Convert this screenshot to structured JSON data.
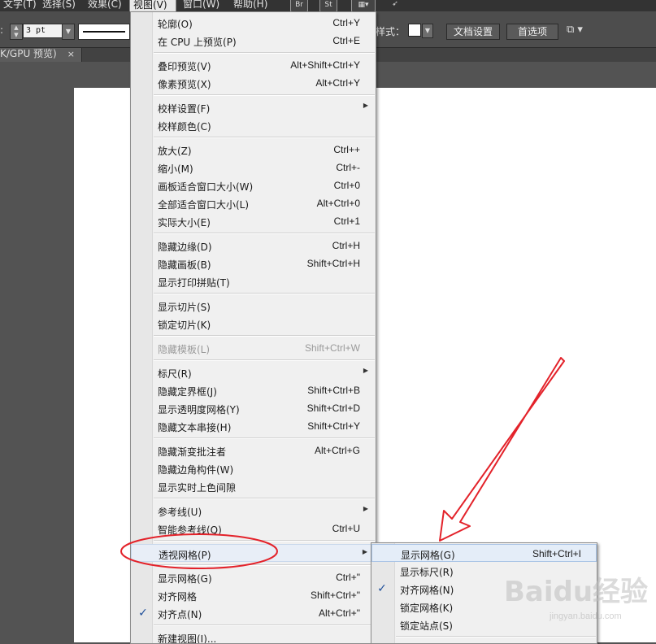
{
  "menubar": {
    "items": [
      "文字(T)",
      "选择(S)",
      "效果(C)",
      "视图(V)",
      "窗口(W)",
      "帮助(H)"
    ],
    "icons": [
      "Br",
      "St"
    ]
  },
  "controlbar": {
    "stroke_value": "3 pt",
    "style_label": "样式：",
    "doc_setup": "文档设置",
    "preferences": "首选项"
  },
  "doc_tab": {
    "label": "K/GPU 预览)",
    "close": "×"
  },
  "view_menu": {
    "items": [
      {
        "label": "轮廓(O)",
        "shortcut": "Ctrl+Y"
      },
      {
        "label": "在 CPU 上预览(P)",
        "shortcut": "Ctrl+E"
      },
      {
        "label": "叠印预览(V)",
        "shortcut": "Alt+Shift+Ctrl+Y"
      },
      {
        "label": "像素预览(X)",
        "shortcut": "Alt+Ctrl+Y"
      },
      {
        "label": "校样设置(F)",
        "shortcut": ""
      },
      {
        "label": "校样颜色(C)",
        "shortcut": ""
      },
      {
        "label": "放大(Z)",
        "shortcut": "Ctrl++"
      },
      {
        "label": "缩小(M)",
        "shortcut": "Ctrl+-"
      },
      {
        "label": "画板适合窗口大小(W)",
        "shortcut": "Ctrl+0"
      },
      {
        "label": "全部适合窗口大小(L)",
        "shortcut": "Alt+Ctrl+0"
      },
      {
        "label": "实际大小(E)",
        "shortcut": "Ctrl+1"
      },
      {
        "label": "隐藏边缘(D)",
        "shortcut": "Ctrl+H"
      },
      {
        "label": "隐藏画板(B)",
        "shortcut": "Shift+Ctrl+H"
      },
      {
        "label": "显示打印拼贴(T)",
        "shortcut": ""
      },
      {
        "label": "显示切片(S)",
        "shortcut": ""
      },
      {
        "label": "锁定切片(K)",
        "shortcut": ""
      },
      {
        "label": "隐藏模板(L)",
        "shortcut": "Shift+Ctrl+W"
      },
      {
        "label": "标尺(R)",
        "shortcut": ""
      },
      {
        "label": "隐藏定界框(J)",
        "shortcut": "Shift+Ctrl+B"
      },
      {
        "label": "显示透明度网格(Y)",
        "shortcut": "Shift+Ctrl+D"
      },
      {
        "label": "隐藏文本串接(H)",
        "shortcut": "Shift+Ctrl+Y"
      },
      {
        "label": "隐藏渐变批注者",
        "shortcut": "Alt+Ctrl+G"
      },
      {
        "label": "隐藏边角构件(W)",
        "shortcut": ""
      },
      {
        "label": "显示实时上色间隙",
        "shortcut": ""
      },
      {
        "label": "参考线(U)",
        "shortcut": ""
      },
      {
        "label": "智能参考线(Q)",
        "shortcut": "Ctrl+U"
      },
      {
        "label": "透视网格(P)",
        "shortcut": ""
      },
      {
        "label": "显示网格(G)",
        "shortcut": "Ctrl+\""
      },
      {
        "label": "对齐网格",
        "shortcut": "Shift+Ctrl+\""
      },
      {
        "label": "对齐点(N)",
        "shortcut": "Alt+Ctrl+\""
      },
      {
        "label": "新建视图(I)...",
        "shortcut": ""
      }
    ]
  },
  "perspective_submenu": {
    "items": [
      {
        "label": "显示网格(G)",
        "shortcut": "Shift+Ctrl+I"
      },
      {
        "label": "显示标尺(R)",
        "shortcut": ""
      },
      {
        "label": "对齐网格(N)",
        "shortcut": ""
      },
      {
        "label": "锁定网格(K)",
        "shortcut": ""
      },
      {
        "label": "锁定站点(S)",
        "shortcut": ""
      }
    ]
  },
  "check_mark": "✓",
  "submenu_arrow": "▶",
  "watermark": {
    "text": "Baidu经验",
    "sub": "jingyan.baidu.com"
  },
  "colors": {
    "annotation_red": "#e3222a",
    "menu_bg": "#f0f0f0",
    "check_blue": "#1f4f9a"
  }
}
